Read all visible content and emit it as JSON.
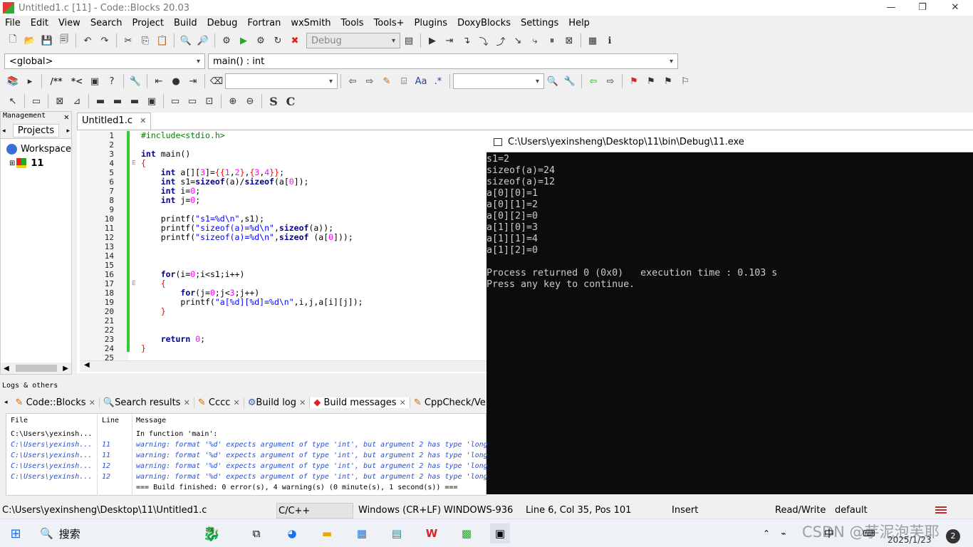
{
  "window": {
    "title": "Untitled1.c [11] - Code::Blocks 20.03",
    "minimize": "—",
    "maximize": "❐",
    "close": "✕"
  },
  "menu": [
    "File",
    "Edit",
    "View",
    "Search",
    "Project",
    "Build",
    "Debug",
    "Fortran",
    "wxSmith",
    "Tools",
    "Tools+",
    "Plugins",
    "DoxyBlocks",
    "Settings",
    "Help"
  ],
  "toolbar": {
    "build_target": "Debug",
    "scope": "<global>",
    "function": "main() : int",
    "doxy_comment1": "/**",
    "doxy_comment2": "*<"
  },
  "management": {
    "title": "Management",
    "tab": "Projects",
    "workspace": "Workspace",
    "project": "11"
  },
  "editor": {
    "tab": "Untitled1.c",
    "line_numbers": [
      "1",
      "2",
      "3",
      "4",
      "5",
      "6",
      "7",
      "8",
      "9",
      "10",
      "11",
      "12",
      "13",
      "14",
      "15",
      "16",
      "17",
      "18",
      "19",
      "20",
      "21",
      "22",
      "23",
      "24",
      "25"
    ]
  },
  "console": {
    "title": "C:\\Users\\yexinsheng\\Desktop\\11\\bin\\Debug\\11.exe",
    "output": "s1=2\nsizeof(a)=24\nsizeof(a)=12\na[0][0]=1\na[0][1]=2\na[0][2]=0\na[1][0]=3\na[1][1]=4\na[1][2]=0\n\nProcess returned 0 (0x0)   execution time : 0.103 s\nPress any key to continue."
  },
  "logs": {
    "title": "Logs & others",
    "tabs": [
      "Code::Blocks",
      "Search results",
      "Cccc",
      "Build log",
      "Build messages",
      "CppCheck/Ve"
    ],
    "columns": [
      "File",
      "Line",
      "Message"
    ],
    "rows": [
      {
        "file": "C:\\Users\\yexinsh...",
        "line": "",
        "message": "In function 'main':",
        "kind": "info"
      },
      {
        "file": "C:\\Users\\yexinsh...",
        "line": "11",
        "message": "warning: format '%d' expects argument of type 'int', but argument 2 has type 'long",
        "kind": "warn"
      },
      {
        "file": "C:\\Users\\yexinsh...",
        "line": "11",
        "message": "warning: format '%d' expects argument of type 'int', but argument 2 has type 'long",
        "kind": "warn"
      },
      {
        "file": "C:\\Users\\yexinsh...",
        "line": "12",
        "message": "warning: format '%d' expects argument of type 'int', but argument 2 has type 'long",
        "kind": "warn"
      },
      {
        "file": "C:\\Users\\yexinsh...",
        "line": "12",
        "message": "warning: format '%d' expects argument of type 'int', but argument 2 has type 'long",
        "kind": "warn"
      },
      {
        "file": "",
        "line": "",
        "message": "=== Build finished: 0 error(s), 4 warning(s) (0 minute(s), 1 second(s)) ===",
        "kind": "info"
      }
    ]
  },
  "status": {
    "path": "C:\\Users\\yexinsheng\\Desktop\\11\\Untitled1.c",
    "lang": "C/C++",
    "eol": "Windows (CR+LF)",
    "encoding": "WINDOWS-936",
    "position": "Line 6, Col 35, Pos 101",
    "mode": "Insert",
    "access": "Read/Write",
    "profile": "default"
  },
  "taskbar": {
    "search": "搜索",
    "ime": "中",
    "date": "2025/1/23",
    "watermark": "CSDN @芋泥泡芙耶",
    "notif": "2"
  }
}
